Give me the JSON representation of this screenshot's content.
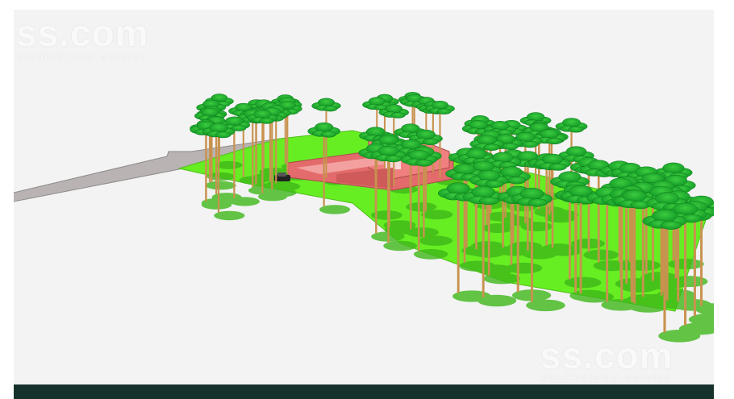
{
  "watermark": {
    "brand": "ss.com",
    "tagline": "sludinājumu serviss"
  },
  "colors": {
    "background": "#f3f3f3",
    "grass": "#66ee22",
    "road": "#b9b3b3",
    "building": "#e36b6b",
    "trunk": "#c8924f",
    "canopy": "#22b531",
    "footer": "#17322c"
  },
  "scene": {
    "description_icon": "3d-site-model",
    "objects": [
      "plot",
      "road",
      "house",
      "car",
      "trees"
    ]
  }
}
